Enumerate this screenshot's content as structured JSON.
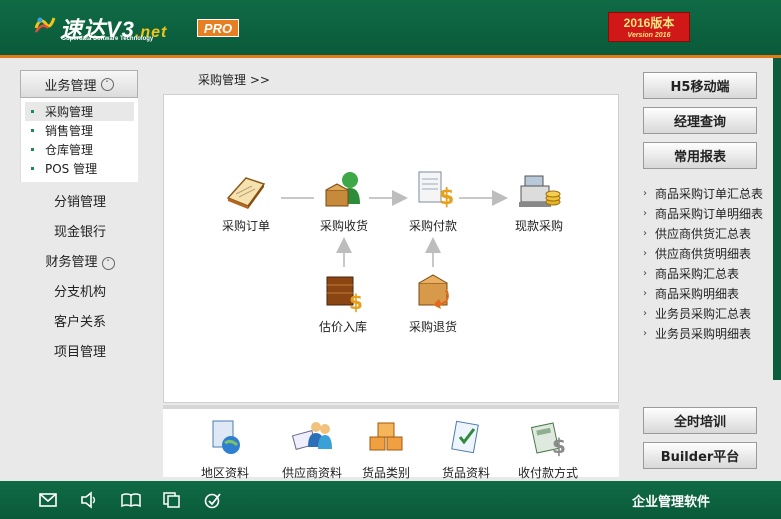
{
  "header": {
    "logo_name": "速达V3",
    "logo_suffix": ".net",
    "logo_subtitle": "Superdata Software Technology",
    "pro_badge": "PRO",
    "version_title": "2016版本",
    "version_sub": "Version 2016",
    "accent_color": "#e07b17",
    "brand_color": "#0f6b45"
  },
  "sidebar": {
    "business_header": "业务管理",
    "sub_items": [
      {
        "label": "采购管理",
        "active": true
      },
      {
        "label": "销售管理"
      },
      {
        "label": "仓库管理"
      },
      {
        "label": "POS 管理"
      }
    ],
    "links": [
      "分销管理",
      "现金银行"
    ],
    "finance": "财务管理",
    "links2": [
      "分支机构",
      "客户关系",
      "项目管理"
    ]
  },
  "breadcrumb": "采购管理  >>",
  "workflow": {
    "nodes": {
      "order": "采购订单",
      "receive": "采购收货",
      "pay": "采购付款",
      "cash": "现款采购",
      "estimate": "估价入库",
      "return": "采购退货"
    },
    "icons": {
      "order": "book-icon",
      "receive": "box-person-icon",
      "pay": "invoice-coin-icon",
      "cash": "cash-register-icon",
      "estimate": "warehouse-coin-icon",
      "return": "return-box-icon"
    }
  },
  "basic_data": {
    "items": [
      "地区资料",
      "供应商资料",
      "货品类别",
      "货品资料",
      "收付款方式"
    ]
  },
  "right_panel": {
    "buttons_top": [
      "H5移动端",
      "经理查询",
      "常用报表"
    ],
    "reports": [
      "商品采购订单汇总表",
      "商品采购订单明细表",
      "供应商供货汇总表",
      "供应商供货明细表",
      "商品采购汇总表",
      "商品采购明细表",
      "业务员采购汇总表",
      "业务员采购明细表"
    ],
    "buttons_bottom": [
      "全时培训",
      "Builder平台"
    ]
  },
  "footer": {
    "title": "企业管理软件",
    "icons": [
      "mail-icon",
      "speaker-icon",
      "book-open-icon",
      "copy-icon",
      "check-circle-icon"
    ]
  }
}
